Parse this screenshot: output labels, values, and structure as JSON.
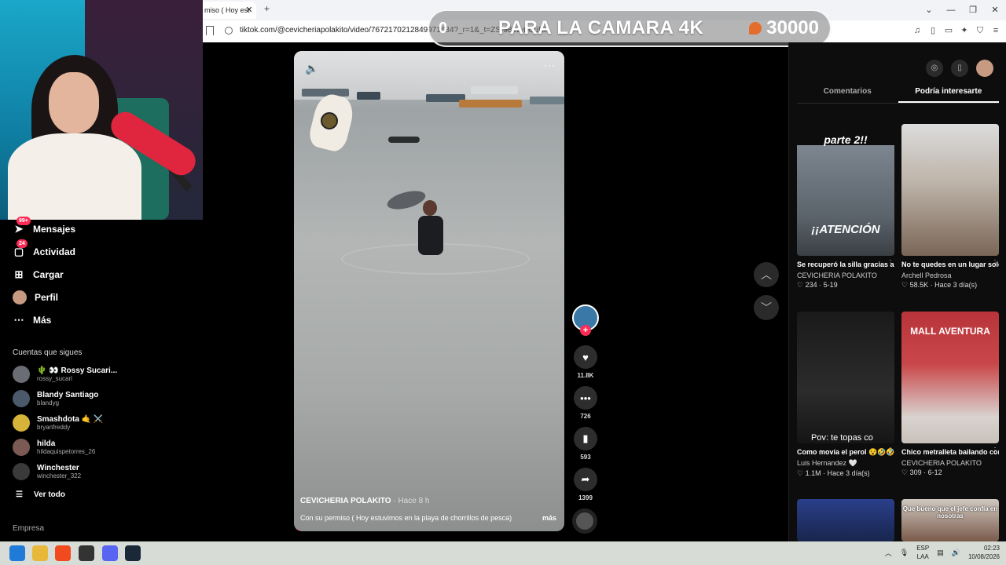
{
  "browser": {
    "tab_title": "miso ( Hoy est",
    "tab_close": "✕",
    "new_tab": "+",
    "url": "tiktok.com/@cevicheriapolakito/video/7672170212849971634?_r=1&_t=ZS-98kvynUuRI",
    "window_controls": [
      "⌄",
      "—",
      "❐",
      "✕"
    ]
  },
  "goal_banner": {
    "current": "0",
    "text": "PARA LA CAMARA 4K",
    "target": "30000",
    "accent": "#e46c2c"
  },
  "sidebar": {
    "nav": [
      {
        "label": "Mensajes",
        "icon": "paper-plane-icon",
        "badge": "99+"
      },
      {
        "label": "Actividad",
        "icon": "inbox-icon",
        "badge": "24"
      },
      {
        "label": "Cargar",
        "icon": "upload-icon",
        "badge": ""
      },
      {
        "label": "Perfil",
        "icon": "avatar",
        "badge": ""
      },
      {
        "label": "Más",
        "icon": "more-dots-icon",
        "badge": ""
      }
    ],
    "following_title": "Cuentas que sigues",
    "following": [
      {
        "name": "🌵 👀 Rossy Sucari...",
        "handle": "rossy_sucari"
      },
      {
        "name": "Blandy Santiago",
        "handle": "blandyg"
      },
      {
        "name": "Smashdota 🤙 ⚔️",
        "handle": "bryanfreddy"
      },
      {
        "name": "hilda",
        "handle": "hildaquispetorres_26"
      },
      {
        "name": "Winchester",
        "handle": "winchester_322"
      }
    ],
    "see_all": "Ver todo",
    "company": "Empresa"
  },
  "video": {
    "author": "CEVICHERIA POLAKITO",
    "time": " · Hace 8 h",
    "caption": "Con su permiso ( Hoy estuvimos en la playa de chorrillos de pesca)",
    "more": "más",
    "progress": 0.02
  },
  "actions": {
    "likes": "11.8K",
    "comments": "726",
    "saves": "593",
    "shares": "1399"
  },
  "right_panel": {
    "tabs": [
      "Comentarios",
      "Podría interesarte"
    ],
    "active_tab": "Podría interesarte",
    "cards": [
      {
        "title": "Se recuperó la silla gracias a la Chica del ...",
        "author": "CEVICHERIA POLAKITO",
        "likes": "234",
        "date": "5-19",
        "overlay_top": "parte 2!!",
        "overlay_bottom": "¡¡ATENCIÓN",
        "theme": "#6d7680"
      },
      {
        "title": "No te quedes en un lugar solo por miedo, l...",
        "author": "Archell Pedrosa",
        "likes": "58.5K",
        "date": "Hace 3 día(s)",
        "overlay_top": "",
        "overlay_bottom": "",
        "theme": "#8a7a68"
      },
      {
        "title": "Como movía el perol 😵🤣🤣🤣 #🤣...",
        "author": "Luis Hernandez 🤍",
        "likes": "1.1M",
        "date": "Hace 3 día(s)",
        "overlay_top": "",
        "overlay_bottom": "Pov: te topas co",
        "theme": "#1f1f1f"
      },
      {
        "title": "Chico metralleta bailando con la abueli...",
        "author": "CEVICHERIA POLAKITO",
        "likes": "309",
        "date": "6-12",
        "overlay_top": "MALL AVENTURA",
        "overlay_bottom": "",
        "theme": "#b8343a"
      },
      {
        "title": "",
        "author": "",
        "likes": "",
        "date": "",
        "overlay_top": "",
        "overlay_bottom": "",
        "theme": "#2a3f8a"
      },
      {
        "title": "",
        "author": "",
        "likes": "",
        "date": "",
        "overlay_top": "Que bueno que el jefe confía en nosotras",
        "overlay_bottom": "",
        "theme": "#7a5a4a"
      }
    ]
  },
  "taskbar": {
    "lang_top": "ESP",
    "lang_bottom": "LAA",
    "time": "02:23",
    "date": "10/08/2026"
  }
}
